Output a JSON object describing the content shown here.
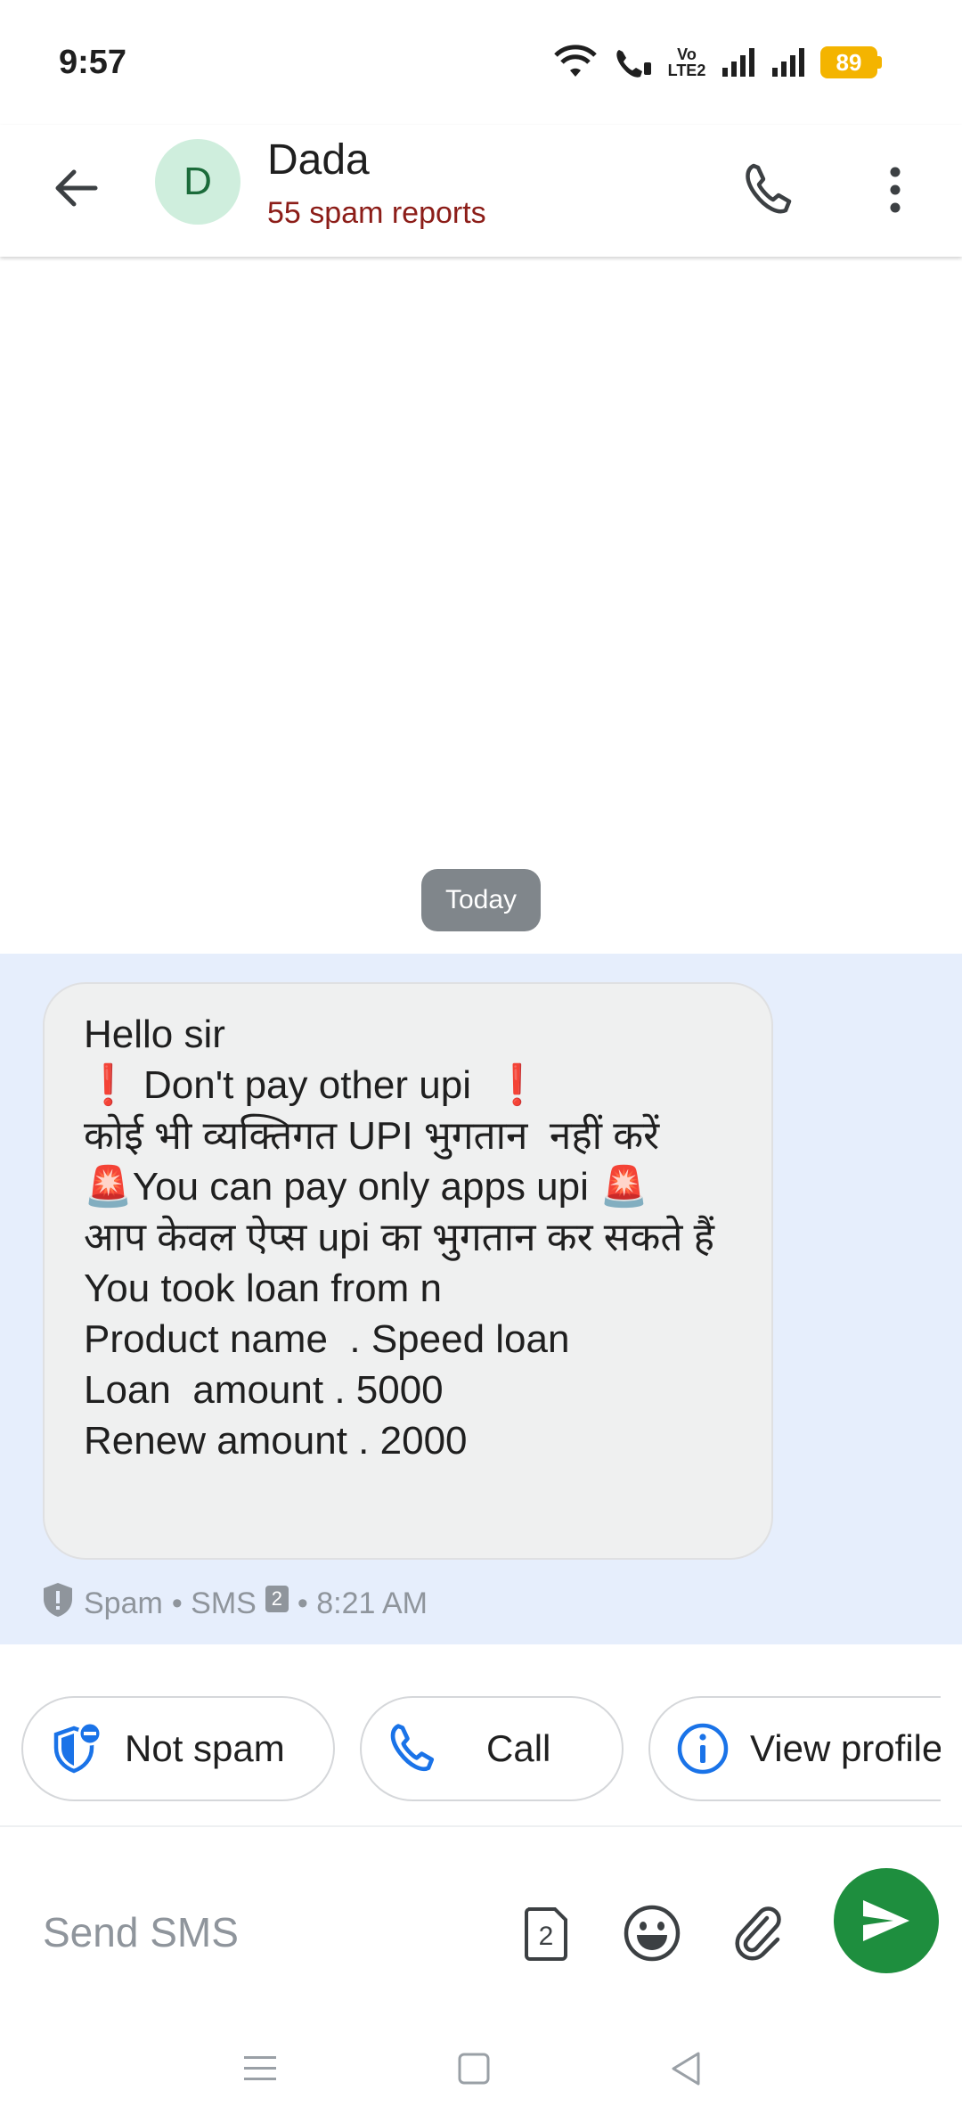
{
  "status_bar": {
    "time": "9:57",
    "volte_line1": "Vo",
    "volte_line2": "LTE2",
    "battery": "89"
  },
  "header": {
    "avatar_letter": "D",
    "contact_name": "Dada",
    "spam_reports": "55 spam reports"
  },
  "conversation": {
    "date_chip": "Today",
    "message_text": "Hello sir\n❗ Don't pay other upi  ❗\nकोई भी व्यक्तिगत UPI भुगतान  नहीं करें\n🚨You can pay only apps upi 🚨\nआप केवल ऐप्स upi का भुगतान कर सकते हैं\nYou took loan from n\nProduct name  . Speed loan\nLoan  amount . 5000\nRenew amount . 2000",
    "meta_spam": "Spam",
    "meta_sms": "• SMS",
    "meta_sim": "2",
    "meta_time": "• 8:21 AM"
  },
  "actions": {
    "not_spam": "Not spam",
    "call": "Call",
    "view_profile": "View profile"
  },
  "compose": {
    "placeholder": "Send SMS",
    "sim_number": "2"
  },
  "colors": {
    "accent_green": "#1e8e3e",
    "spam_red": "#8c1d18",
    "spam_zone_bg": "#e6eefc",
    "icon_blue": "#1a73e8",
    "battery": "#f4b400"
  },
  "icons": {
    "back": "arrow-left-icon",
    "phone": "phone-icon",
    "more": "more-vert-icon",
    "shield": "shield-icon",
    "info": "info-icon",
    "emoji": "emoji-icon",
    "attach": "paperclip-icon",
    "send": "send-icon"
  }
}
